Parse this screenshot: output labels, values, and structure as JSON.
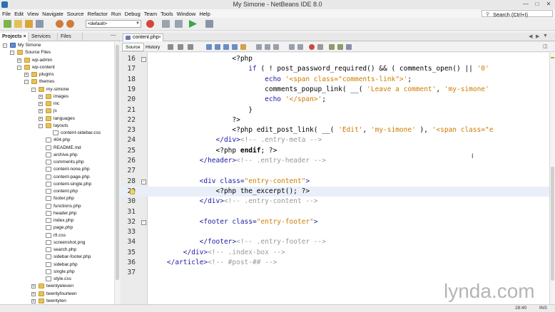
{
  "window": {
    "title": "My Simone - NetBeans IDE 8.0"
  },
  "menu": {
    "items": [
      "File",
      "Edit",
      "View",
      "Navigate",
      "Source",
      "Refactor",
      "Run",
      "Debug",
      "Team",
      "Tools",
      "Window",
      "Help"
    ],
    "search_placeholder": "Search (Ctrl+I)"
  },
  "toolbar": {
    "config_value": "<default>"
  },
  "left_panel": {
    "tabs": [
      "Projects",
      "Services",
      "Files"
    ],
    "tree": [
      {
        "label": "My Simone",
        "depth": 0,
        "kind": "proj",
        "toggle": "-"
      },
      {
        "label": "Source Files",
        "depth": 1,
        "kind": "folder",
        "toggle": "-"
      },
      {
        "label": "wp-admin",
        "depth": 2,
        "kind": "folder",
        "toggle": "+"
      },
      {
        "label": "wp-content",
        "depth": 2,
        "kind": "folder",
        "toggle": "-"
      },
      {
        "label": "plugins",
        "depth": 3,
        "kind": "folder",
        "toggle": "+"
      },
      {
        "label": "themes",
        "depth": 3,
        "kind": "folder",
        "toggle": "-"
      },
      {
        "label": "my-simone",
        "depth": 4,
        "kind": "folder",
        "toggle": "-"
      },
      {
        "label": "images",
        "depth": 5,
        "kind": "folder",
        "toggle": "+"
      },
      {
        "label": "inc",
        "depth": 5,
        "kind": "folder",
        "toggle": "+"
      },
      {
        "label": "js",
        "depth": 5,
        "kind": "folder",
        "toggle": "+"
      },
      {
        "label": "languages",
        "depth": 5,
        "kind": "folder",
        "toggle": "+"
      },
      {
        "label": "layouts",
        "depth": 5,
        "kind": "folder",
        "toggle": "-"
      },
      {
        "label": "content-sidebar.css",
        "depth": 6,
        "kind": "file",
        "toggle": ""
      },
      {
        "label": "404.php",
        "depth": 5,
        "kind": "file",
        "toggle": ""
      },
      {
        "label": "README.md",
        "depth": 5,
        "kind": "file",
        "toggle": ""
      },
      {
        "label": "archive.php",
        "depth": 5,
        "kind": "file",
        "toggle": ""
      },
      {
        "label": "comments.php",
        "depth": 5,
        "kind": "file",
        "toggle": ""
      },
      {
        "label": "content-none.php",
        "depth": 5,
        "kind": "file",
        "toggle": ""
      },
      {
        "label": "content-page.php",
        "depth": 5,
        "kind": "file",
        "toggle": ""
      },
      {
        "label": "content-single.php",
        "depth": 5,
        "kind": "file",
        "toggle": ""
      },
      {
        "label": "content.php",
        "depth": 5,
        "kind": "file",
        "toggle": ""
      },
      {
        "label": "footer.php",
        "depth": 5,
        "kind": "file",
        "toggle": ""
      },
      {
        "label": "functions.php",
        "depth": 5,
        "kind": "file",
        "toggle": ""
      },
      {
        "label": "header.php",
        "depth": 5,
        "kind": "file",
        "toggle": ""
      },
      {
        "label": "index.php",
        "depth": 5,
        "kind": "file",
        "toggle": ""
      },
      {
        "label": "page.php",
        "depth": 5,
        "kind": "file",
        "toggle": ""
      },
      {
        "label": "rtl.css",
        "depth": 5,
        "kind": "file",
        "toggle": ""
      },
      {
        "label": "screenshot.png",
        "depth": 5,
        "kind": "file",
        "toggle": ""
      },
      {
        "label": "search.php",
        "depth": 5,
        "kind": "file",
        "toggle": ""
      },
      {
        "label": "sidebar-footer.php",
        "depth": 5,
        "kind": "file",
        "toggle": ""
      },
      {
        "label": "sidebar.php",
        "depth": 5,
        "kind": "file",
        "toggle": ""
      },
      {
        "label": "single.php",
        "depth": 5,
        "kind": "file",
        "toggle": ""
      },
      {
        "label": "style.css",
        "depth": 5,
        "kind": "file",
        "toggle": ""
      },
      {
        "label": "twentyeleven",
        "depth": 4,
        "kind": "folder",
        "toggle": "+"
      },
      {
        "label": "twentyfourteen",
        "depth": 4,
        "kind": "folder",
        "toggle": "+"
      },
      {
        "label": "twentyten",
        "depth": 4,
        "kind": "folder",
        "toggle": "+"
      }
    ]
  },
  "editor": {
    "tab_label": "content.php",
    "view_tabs": [
      "Source",
      "History"
    ],
    "lines": [
      {
        "num": "16",
        "fold": "-",
        "hint": false,
        "current": false,
        "segs": [
          [
            "t",
            "                    <?php"
          ]
        ]
      },
      {
        "num": "17",
        "fold": "",
        "hint": false,
        "current": false,
        "segs": [
          [
            "kw",
            "                        if"
          ],
          [
            "t",
            " ( ! post_password_required() && ( comments_open() || "
          ],
          [
            "s",
            "'0'"
          ]
        ]
      },
      {
        "num": "18",
        "fold": "",
        "hint": false,
        "current": false,
        "segs": [
          [
            "kw",
            "                            echo"
          ],
          [
            "t",
            " "
          ],
          [
            "s",
            "'<span class=\"comments-link\">'"
          ],
          [
            "t",
            ";"
          ]
        ]
      },
      {
        "num": "19",
        "fold": "",
        "hint": false,
        "current": false,
        "segs": [
          [
            "t",
            "                            comments_popup_link( __( "
          ],
          [
            "s",
            "'Leave a comment'"
          ],
          [
            "t",
            ", "
          ],
          [
            "s",
            "'my-simone'"
          ]
        ]
      },
      {
        "num": "20",
        "fold": "",
        "hint": false,
        "current": false,
        "segs": [
          [
            "kw",
            "                            echo"
          ],
          [
            "t",
            " "
          ],
          [
            "s",
            "'</span>'"
          ],
          [
            "t",
            ";"
          ]
        ]
      },
      {
        "num": "21",
        "fold": "",
        "hint": false,
        "current": false,
        "segs": [
          [
            "t",
            "                        }"
          ]
        ]
      },
      {
        "num": "22",
        "fold": "",
        "hint": false,
        "current": false,
        "segs": [
          [
            "t",
            "                    ?>"
          ]
        ]
      },
      {
        "num": "23",
        "fold": "",
        "hint": false,
        "current": false,
        "segs": [
          [
            "t",
            "                    <?php edit_post_link( __( "
          ],
          [
            "s",
            "'Edit'"
          ],
          [
            "t",
            ", "
          ],
          [
            "s",
            "'my-simone'"
          ],
          [
            "t",
            " ), "
          ],
          [
            "s",
            "'<span class=\"e"
          ]
        ]
      },
      {
        "num": "24",
        "fold": "",
        "hint": false,
        "current": false,
        "segs": [
          [
            "tag",
            "                </div>"
          ],
          [
            "c",
            "<!-- .entry-meta -->"
          ]
        ]
      },
      {
        "num": "25",
        "fold": "",
        "hint": false,
        "current": false,
        "segs": [
          [
            "t",
            "                <?php "
          ],
          [
            "b",
            "endif"
          ],
          [
            "t",
            "; ?>"
          ]
        ]
      },
      {
        "num": "26",
        "fold": "",
        "hint": false,
        "current": false,
        "segs": [
          [
            "tag",
            "            </header>"
          ],
          [
            "c",
            "<!-- .entry-header -->"
          ]
        ]
      },
      {
        "num": "27",
        "fold": "",
        "hint": false,
        "current": false,
        "segs": [
          [
            "t",
            ""
          ]
        ]
      },
      {
        "num": "28",
        "fold": "-",
        "hint": false,
        "current": false,
        "segs": [
          [
            "tag",
            "            <div "
          ],
          [
            "attr",
            "class="
          ],
          [
            "val",
            "\"entry-content\""
          ],
          [
            "tag",
            ">"
          ]
        ]
      },
      {
        "num": "29",
        "fold": "",
        "hint": true,
        "current": true,
        "segs": [
          [
            "t",
            "                <?php the_excerpt(); ?>"
          ]
        ]
      },
      {
        "num": "30",
        "fold": "",
        "hint": false,
        "current": false,
        "segs": [
          [
            "tag",
            "            </div>"
          ],
          [
            "c",
            "<!-- .entry-content -->"
          ]
        ]
      },
      {
        "num": "31",
        "fold": "",
        "hint": false,
        "current": false,
        "segs": [
          [
            "t",
            ""
          ]
        ]
      },
      {
        "num": "32",
        "fold": "-",
        "hint": false,
        "current": false,
        "segs": [
          [
            "tag",
            "            <footer "
          ],
          [
            "attr",
            "class="
          ],
          [
            "val",
            "\"entry-footer\""
          ],
          [
            "tag",
            ">"
          ]
        ]
      },
      {
        "num": "33",
        "fold": "",
        "hint": false,
        "current": false,
        "segs": [
          [
            "t",
            ""
          ]
        ]
      },
      {
        "num": "34",
        "fold": "",
        "hint": false,
        "current": false,
        "segs": [
          [
            "tag",
            "            </footer>"
          ],
          [
            "c",
            "<!-- .entry-footer -->"
          ]
        ]
      },
      {
        "num": "35",
        "fold": "",
        "hint": false,
        "current": false,
        "segs": [
          [
            "tag",
            "        </div>"
          ],
          [
            "c",
            "<!-- .index-box -->"
          ]
        ]
      },
      {
        "num": "36",
        "fold": "",
        "hint": false,
        "current": false,
        "segs": [
          [
            "tag",
            "    </article>"
          ],
          [
            "c",
            "<!-- #post-## -->"
          ]
        ]
      },
      {
        "num": "37",
        "fold": "",
        "hint": false,
        "current": false,
        "segs": [
          [
            "t",
            ""
          ]
        ]
      }
    ]
  },
  "status": {
    "position": "28:40",
    "mode": "INS"
  },
  "watermark": {
    "brand": "lynda",
    "suffix": ".com"
  },
  "colors": {
    "keyword": "#1a1aa6",
    "string": "#ce7b00",
    "tag": "#1a1aa6",
    "attr": "#1a1aa6",
    "value": "#ce7b00",
    "comment": "#999999",
    "php_bold": "#000000"
  }
}
